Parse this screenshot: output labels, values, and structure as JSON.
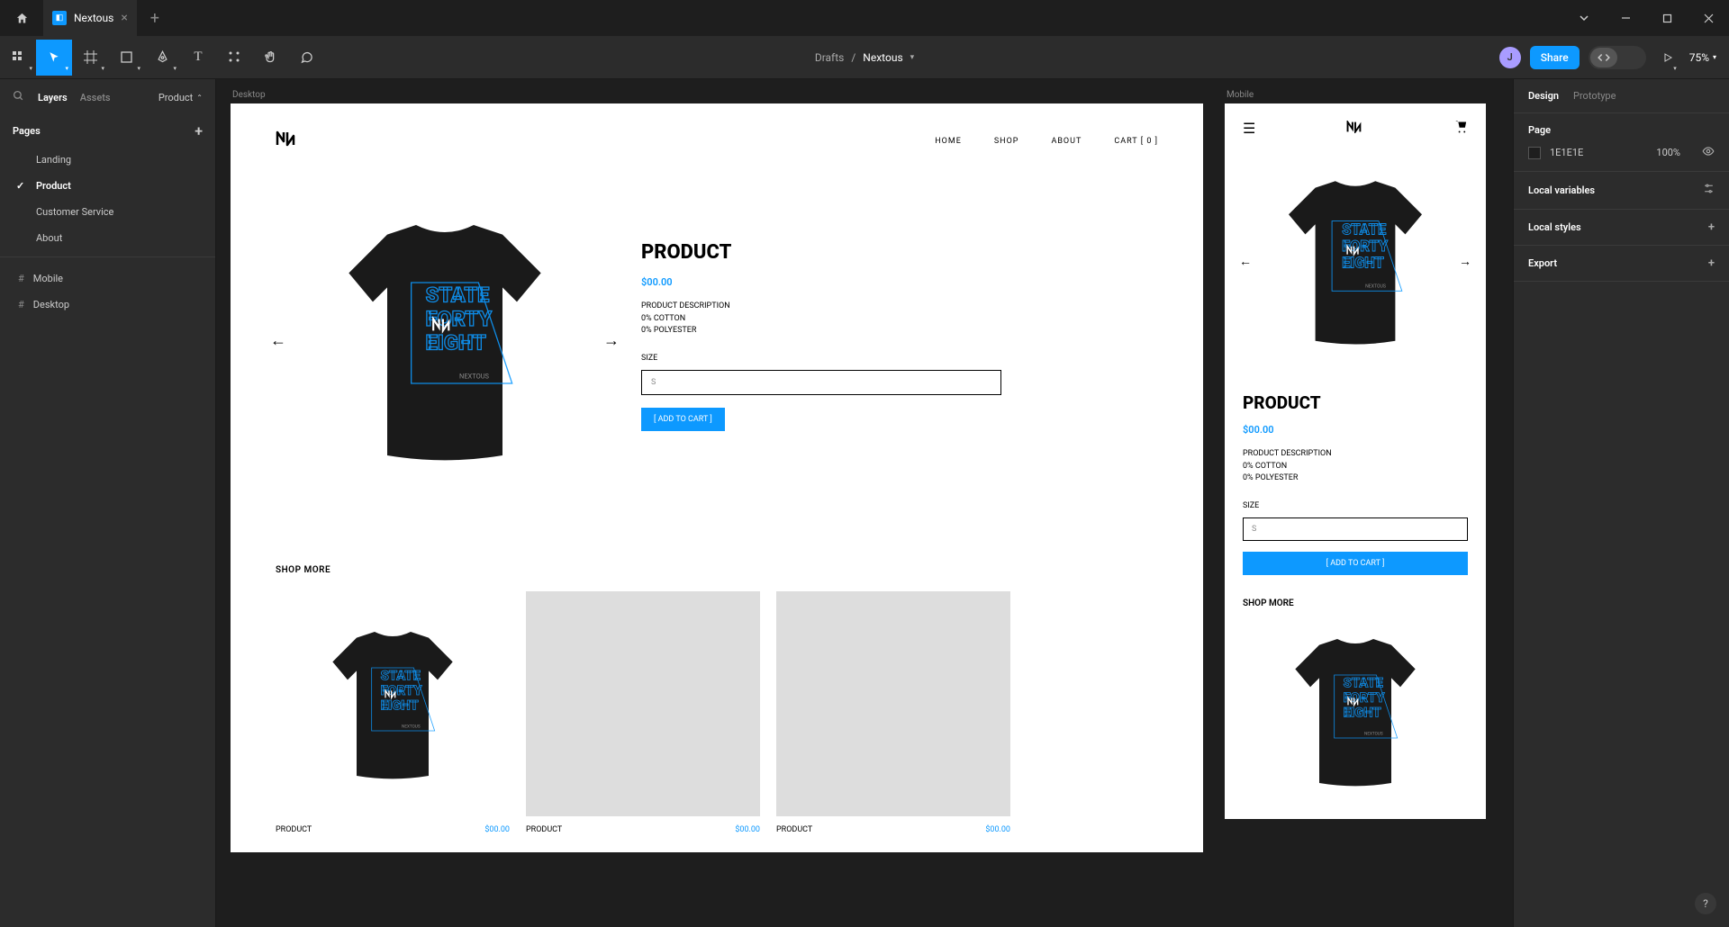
{
  "titlebar": {
    "tab_name": "Nextous"
  },
  "toolbar": {
    "breadcrumb_root": "Drafts",
    "breadcrumb_sep": "/",
    "breadcrumb_title": "Nextous",
    "avatar_initial": "J",
    "share_label": "Share",
    "zoom": "75%"
  },
  "left_panel": {
    "tab_layers": "Layers",
    "tab_assets": "Assets",
    "dropdown": "Product",
    "pages_label": "Pages",
    "pages": [
      {
        "name": "Landing",
        "active": false
      },
      {
        "name": "Product",
        "active": true
      },
      {
        "name": "Customer Service",
        "active": false
      },
      {
        "name": "About",
        "active": false
      }
    ],
    "frames": [
      {
        "name": "Mobile"
      },
      {
        "name": "Desktop"
      }
    ]
  },
  "canvas": {
    "frame_desktop_label": "Desktop",
    "frame_mobile_label": "Mobile",
    "nav": {
      "home": "HOME",
      "shop": "SHOP",
      "about": "ABOUT",
      "cart": "CART [ 0 ]"
    },
    "product": {
      "title": "PRODUCT",
      "price": "$00.00",
      "desc_line1": "PRODUCT DESCRIPTION",
      "desc_line2": "0% COTTON",
      "desc_line3": "0% POLYESTER",
      "size_label": "SIZE",
      "size_value": "S",
      "add_to_cart": "[ ADD TO CART ]"
    },
    "shop_more_label": "SHOP MORE",
    "related": [
      {
        "name": "PRODUCT",
        "price": "$00.00"
      },
      {
        "name": "PRODUCT",
        "price": "$00.00"
      },
      {
        "name": "PRODUCT",
        "price": "$00.00"
      }
    ]
  },
  "right_panel": {
    "tab_design": "Design",
    "tab_prototype": "Prototype",
    "page_label": "Page",
    "page_color": "1E1E1E",
    "page_opacity": "100%",
    "local_variables": "Local variables",
    "local_styles": "Local styles",
    "export": "Export"
  }
}
